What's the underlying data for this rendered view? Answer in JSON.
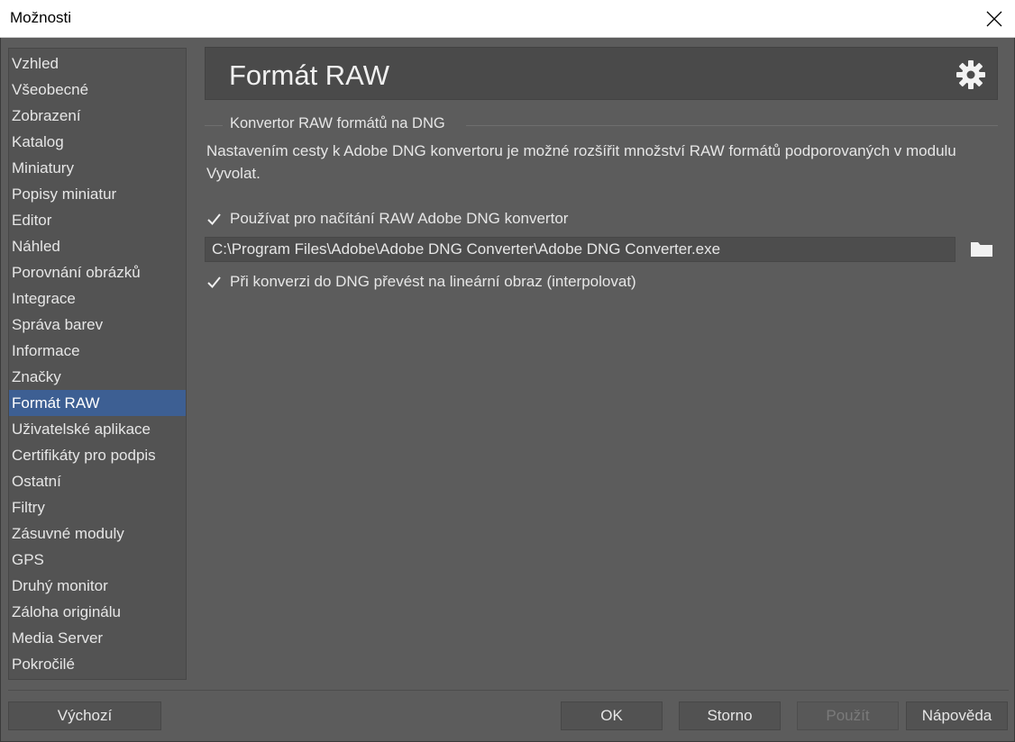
{
  "window": {
    "title": "Možnosti"
  },
  "sidebar": {
    "items": [
      {
        "label": "Vzhled"
      },
      {
        "label": "Všeobecné"
      },
      {
        "label": "Zobrazení"
      },
      {
        "label": "Katalog"
      },
      {
        "label": "Miniatury"
      },
      {
        "label": "Popisy miniatur"
      },
      {
        "label": "Editor"
      },
      {
        "label": "Náhled"
      },
      {
        "label": "Porovnání obrázků"
      },
      {
        "label": "Integrace"
      },
      {
        "label": "Správa barev"
      },
      {
        "label": "Informace"
      },
      {
        "label": "Značky"
      },
      {
        "label": "Formát RAW"
      },
      {
        "label": "Uživatelské aplikace"
      },
      {
        "label": "Certifikáty pro podpis"
      },
      {
        "label": "Ostatní"
      },
      {
        "label": "Filtry"
      },
      {
        "label": "Zásuvné moduly"
      },
      {
        "label": "GPS"
      },
      {
        "label": "Druhý monitor"
      },
      {
        "label": "Záloha originálu"
      },
      {
        "label": "Media Server"
      },
      {
        "label": "Pokročilé"
      }
    ],
    "selected": "Formát RAW"
  },
  "panel": {
    "title": "Formát RAW",
    "settings_icon": "gear-icon",
    "group": {
      "legend": "Konvertor RAW formátů na DNG",
      "description": "Nastavením cesty k Adobe DNG konvertoru je možné rozšířit množství RAW formátů podporovaných v modulu Vyvolat.",
      "use_dng_converter": {
        "label": "Používat pro načítání RAW Adobe DNG konvertor",
        "checked": true
      },
      "converter_path": {
        "value": "C:\\Program Files\\Adobe\\Adobe DNG Converter\\Adobe DNG Converter.exe"
      },
      "folder_icon": "folder-icon",
      "linear_image": {
        "label": "Při konverzi do DNG převést na lineární obraz (interpolovat)",
        "checked": true
      }
    }
  },
  "footer": {
    "default_label": "Výchozí",
    "ok_label": "OK",
    "cancel_label": "Storno",
    "apply_label": "Použít",
    "help_label": "Nápověda"
  },
  "colors": {
    "background": "#5c5c5c",
    "sidebar_selected": "#3d5f93",
    "text": "#e6e6e6"
  }
}
